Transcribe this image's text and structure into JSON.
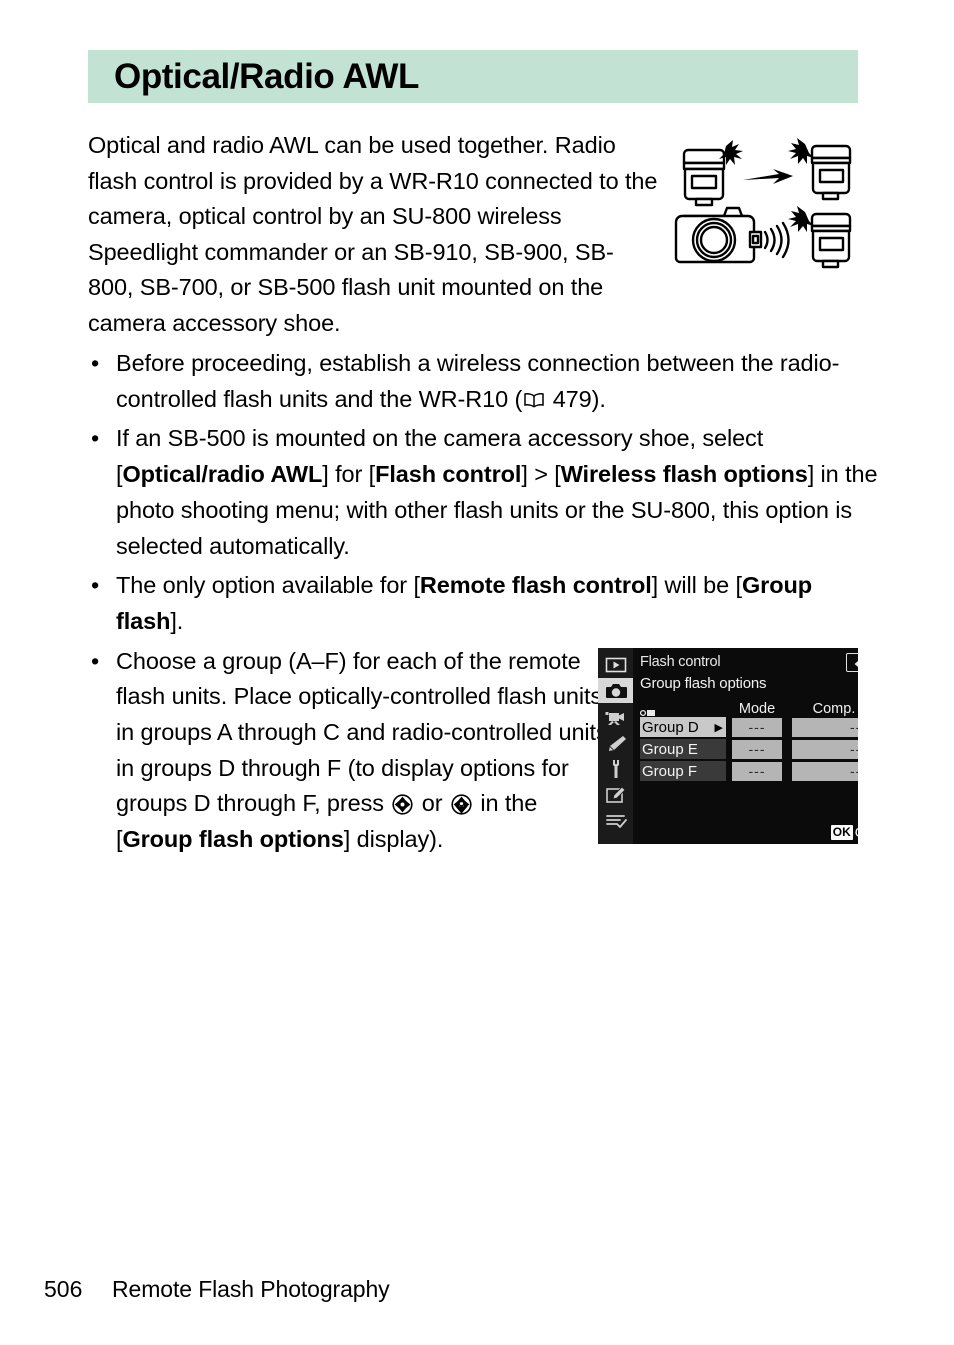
{
  "header": {
    "title": "Optical/Radio AWL",
    "band_color": "#c2e2d4"
  },
  "intro": {
    "paragraph": "Optical and radio AWL can be used together. Radio flash control is provided by a WR-R10 connected to the camera, optical control by an SU-800 wireless Speedlight commander or an SB-910, SB-900, SB-800, SB-700, or SB-500 flash unit mounted on the camera accessory shoe."
  },
  "illustration": {
    "name": "optical-radio-awl-diagram",
    "description": "Camera with mounted flash, optical signal to one remote flash and radio waves to another"
  },
  "bullets": [
    {
      "id": "bullet-wireless-connection",
      "marker": "•",
      "part1": "Before proceeding, establish a wireless connection between the radio-controlled flash units and the WR-R10 (",
      "page_icon": "book-icon",
      "page_ref": "479",
      "part2": ")."
    },
    {
      "id": "bullet-sb500-mounted",
      "marker": "•",
      "seg1": "If an SB-500 is mounted on the camera accessory shoe, select [",
      "bold1": "Optical/radio AWL",
      "seg2": "] for [",
      "bold2": "Flash control",
      "seg3": "] > [",
      "bold3": "Wireless flash options",
      "seg4": "] in the photo shooting menu; with other flash units or the SU-800, this option is selected automatically."
    },
    {
      "id": "bullet-remote-flash-control",
      "marker": "•",
      "seg1": "The only option available for [",
      "bold1": "Remote flash control",
      "seg2": "] will be [",
      "bold2": "Group flash",
      "seg3": "]."
    },
    {
      "id": "bullet-choose-group",
      "marker": "•",
      "seg1": "Choose a group (A–F) for each of the remote flash units. Place optically-controlled flash units in groups A through C and radio-controlled units in groups D through F (to display options for groups D through F, press ",
      "icon_up": "multi-selector-up-icon",
      "seg2": " or ",
      "icon_down": "multi-selector-down-icon",
      "seg3": " in the [",
      "bold1": "Group flash options",
      "seg4": "] display)."
    }
  ],
  "camera_menu": {
    "title": "Flash control",
    "return_icon": "return-arrow-icon",
    "subtitle": "Group flash options",
    "flash_icon": "flash-group-icon",
    "columns": [
      "Mode",
      "Comp."
    ],
    "rows": [
      {
        "label": "Group D",
        "mode": "---",
        "comp": "---",
        "selected": true,
        "arrow": "▶"
      },
      {
        "label": "Group E",
        "mode": "---",
        "comp": "---",
        "selected": false,
        "arrow": "▶"
      },
      {
        "label": "Group F",
        "mode": "---",
        "comp": "---",
        "selected": false,
        "arrow": "▶"
      }
    ],
    "ok_badge": "OK",
    "ok_label": "OK",
    "sidebar_icons": [
      "playback-icon",
      "photo-shooting-menu-icon",
      "movie-shooting-menu-icon",
      "custom-settings-icon",
      "setup-menu-icon",
      "retouch-menu-icon",
      "recent-settings-icon"
    ]
  },
  "footer": {
    "page_number": "506",
    "section": "Remote Flash Photography"
  }
}
